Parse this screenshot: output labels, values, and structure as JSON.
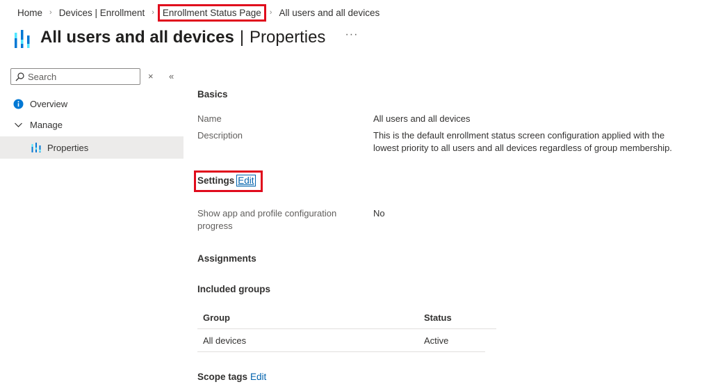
{
  "breadcrumb": [
    "Home",
    "Devices | Enrollment",
    "Enrollment Status Page",
    "All users and all devices"
  ],
  "header": {
    "title": "All users and all devices",
    "subtitle": "Properties",
    "more": "···"
  },
  "sidebar": {
    "search": {
      "placeholder": "Search",
      "value": ""
    },
    "clear_glyph": "×",
    "collapse_glyph": "«",
    "items": [
      {
        "label": "Overview",
        "icon": "info-icon"
      },
      {
        "label": "Manage",
        "icon": "chevron-down-icon"
      },
      {
        "label": "Properties",
        "icon": "properties-icon",
        "selected": true
      }
    ]
  },
  "basics": {
    "heading": "Basics",
    "name_label": "Name",
    "name_value": "All users and all devices",
    "description_label": "Description",
    "description_value": "This is the default enrollment status screen configuration applied with the lowest priority to all users and all devices regardless of group membership."
  },
  "settings": {
    "heading": "Settings",
    "edit": "Edit",
    "show_progress_label": "Show app and profile configuration progress",
    "show_progress_value": "No"
  },
  "assignments": {
    "heading": "Assignments",
    "included_heading": "Included groups",
    "columns": [
      "Group",
      "Status"
    ],
    "rows": [
      {
        "group": "All devices",
        "status": "Active"
      }
    ]
  },
  "scope_tags": {
    "heading": "Scope tags",
    "edit": "Edit"
  },
  "colors": {
    "accent": "#0062ad",
    "highlight_box": "#e00b1c",
    "selected_bg": "#ecebea"
  }
}
